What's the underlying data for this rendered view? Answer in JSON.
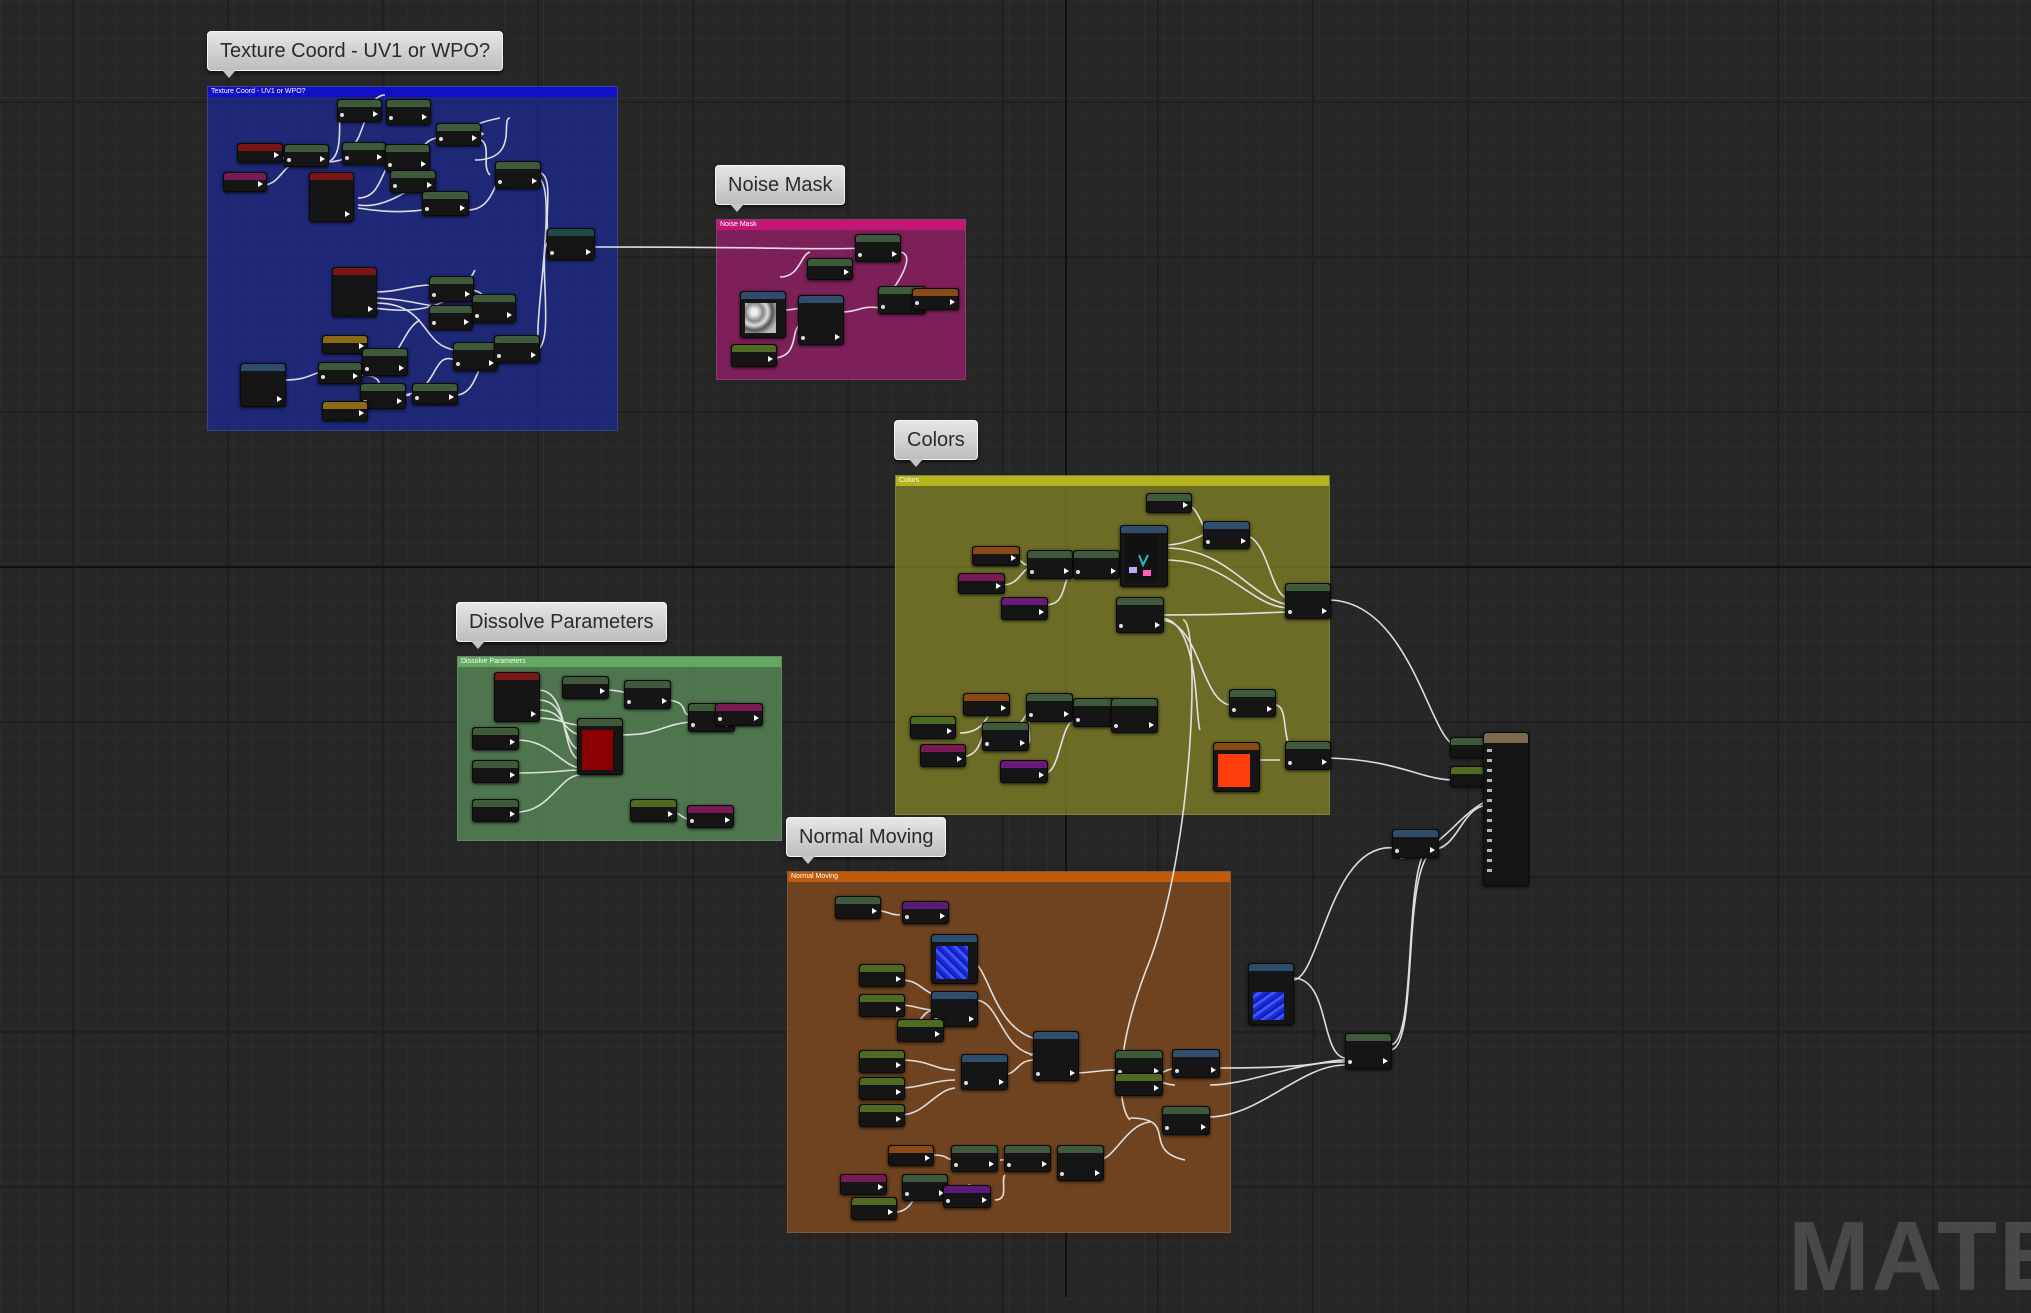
{
  "comments": {
    "texture_coord": {
      "title": "Texture Coord - UV1 or WPO?",
      "header": "Texture Coord - UV1 or WPO?",
      "color": "#1c2a86"
    },
    "noise_mask": {
      "title": "Noise Mask",
      "header": "Noise Mask",
      "color": "#8a1f5e"
    },
    "colors": {
      "title": "Colors",
      "header": "Colors",
      "color": "#737224"
    },
    "dissolve": {
      "title": "Dissolve Parameters",
      "header": "Dissolve Parameters",
      "color": "#4d7a4d"
    },
    "normal_moving": {
      "title": "Normal Moving",
      "header": "Normal Moving",
      "color": "#6e401b"
    }
  },
  "watermark": "MATEF",
  "colors": {
    "graph_background": "#262626",
    "wire": "#e8e8e8",
    "node_green": "#3f5a3a",
    "node_blue": "#2f4e6d",
    "node_red": "#7a1518",
    "node_orange": "#8a4a16",
    "node_magenta": "#7a1a54",
    "node_purple": "#5a1a7a",
    "node_yellow_green": "#4f6a21",
    "node_brown": "#7a6a50",
    "node_teal": "#1f4a48",
    "param_red_preview": "#8b0000",
    "param_orange_preview": "#ff3d0a",
    "texture_blue_preview": "#1a2bd6"
  }
}
